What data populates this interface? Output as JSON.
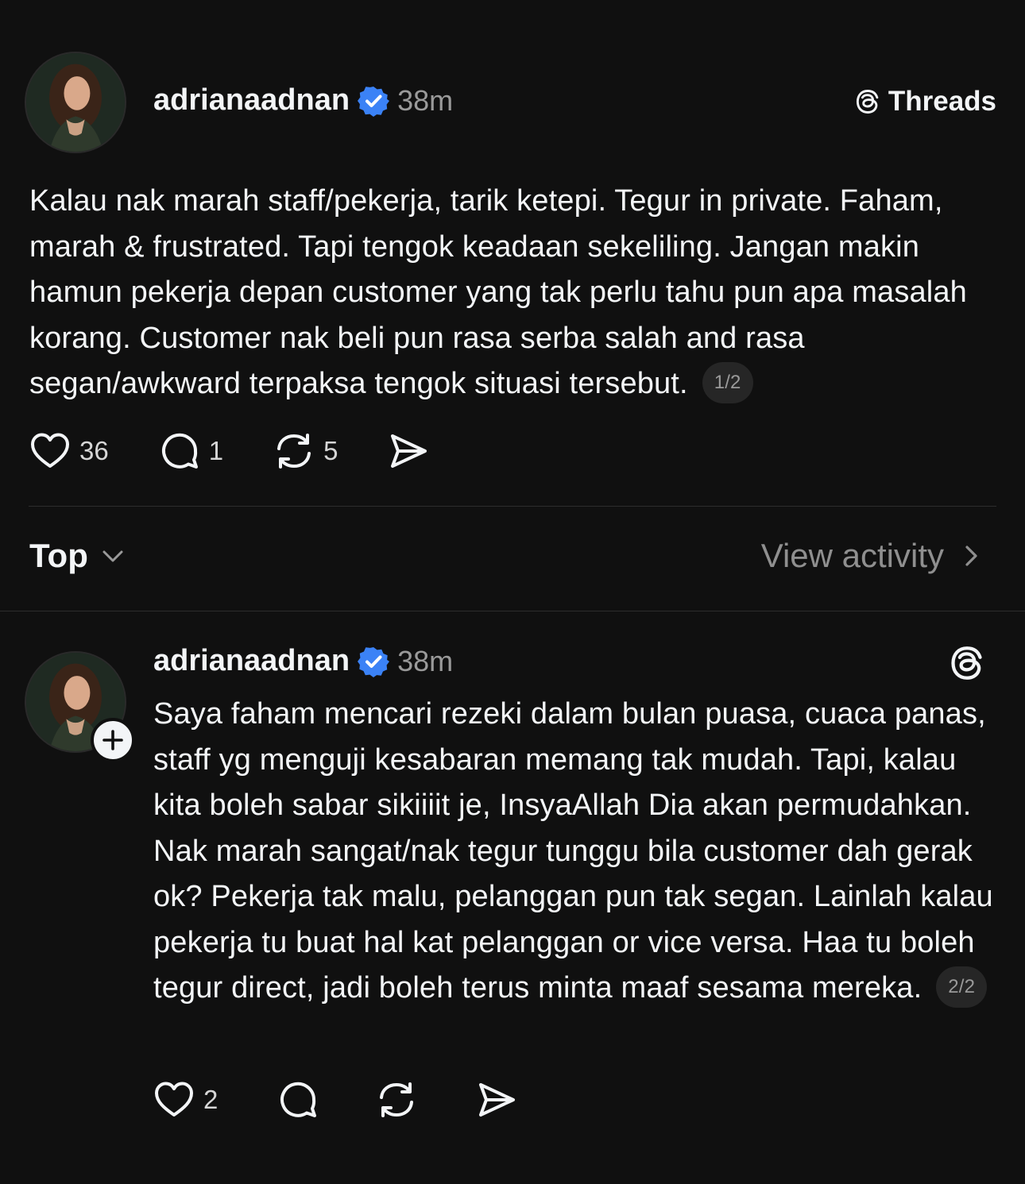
{
  "header": {
    "brand_label": "Threads",
    "brand_icon": "threads-logo-icon"
  },
  "post": {
    "username": "adrianaadnan",
    "verified_icon": "verified-badge-icon",
    "time": "38m",
    "text": "Kalau nak marah staff/pekerja, tarik ketepi. Tegur in private. Faham, marah & frustrated. Tapi tengok keadaan sekeliling. Jangan makin hamun pekerja depan customer yang tak perlu tahu pun apa masalah korang. Customer nak beli pun rasa serba salah and rasa segan/awkward terpaksa tengok situasi tersebut.",
    "pager": "1/2",
    "likes": "36",
    "replies": "1",
    "reposts": "5"
  },
  "replies_bar": {
    "sort_label": "Top",
    "view_activity_label": "View activity"
  },
  "reply": {
    "username": "adrianaadnan",
    "time": "38m",
    "text": "Saya faham mencari rezeki dalam bulan puasa, cuaca panas, staff yg menguji kesabaran memang tak mudah. Tapi, kalau kita boleh sabar sikiiiit je, InsyaAllah Dia akan permudahkan. Nak marah sangat/nak tegur tunggu bila customer dah gerak ok? Pekerja tak malu, pelanggan pun tak segan. Lainlah kalau pekerja tu buat hal kat pelanggan or vice versa. Haa tu boleh tegur direct, jadi boleh terus minta maaf sesama mereka.",
    "pager": "2/2",
    "likes": "2"
  },
  "colors": {
    "background": "#101010",
    "text": "#f3f5f7",
    "muted": "#9a9a9a",
    "verified": "#3b82f6",
    "pill": "#262626"
  }
}
